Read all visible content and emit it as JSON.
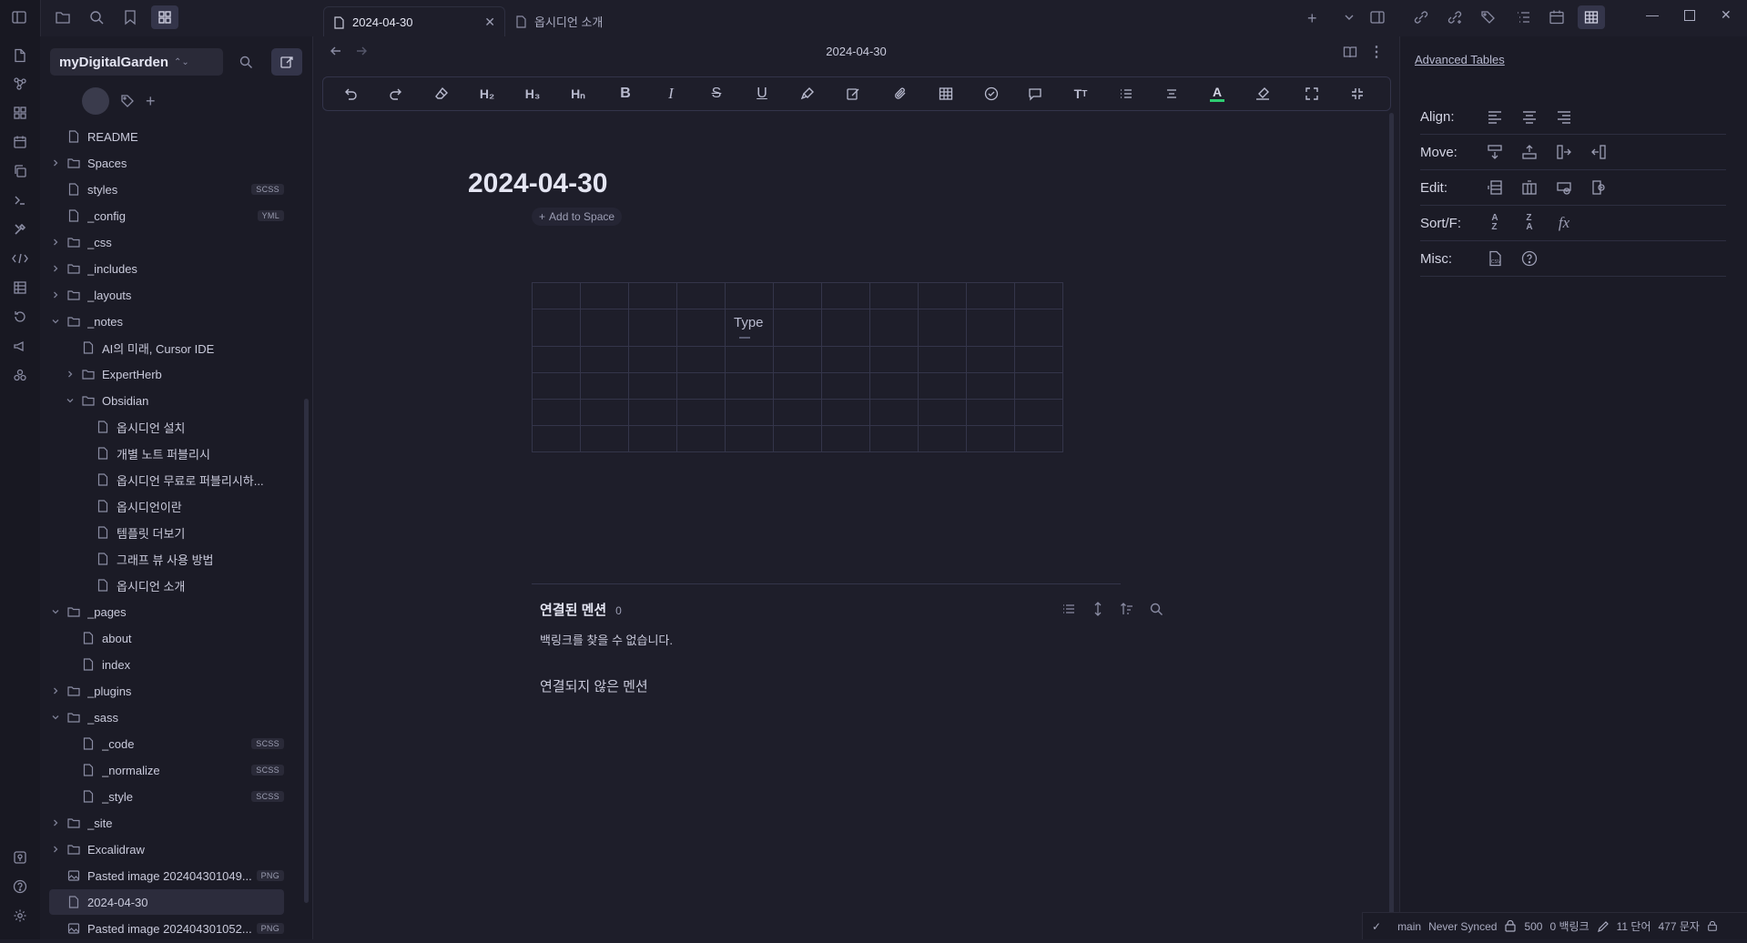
{
  "topbar": {
    "tabs": [
      {
        "label": "2024-04-30",
        "active": true
      },
      {
        "label": "옵시디언 소개",
        "active": false
      }
    ]
  },
  "sidebar": {
    "vault_name": "myDigitalGarden",
    "tree": [
      {
        "name": "README",
        "type": "file",
        "depth": 0
      },
      {
        "name": "Spaces",
        "type": "folder",
        "depth": 0,
        "expanded": false
      },
      {
        "name": "styles",
        "type": "file",
        "depth": 0,
        "badge": "SCSS"
      },
      {
        "name": "_config",
        "type": "file",
        "depth": 0,
        "badge": "YML"
      },
      {
        "name": "_css",
        "type": "folder",
        "depth": 0,
        "expanded": false
      },
      {
        "name": "_includes",
        "type": "folder",
        "depth": 0,
        "expanded": false
      },
      {
        "name": "_layouts",
        "type": "folder",
        "depth": 0,
        "expanded": false
      },
      {
        "name": "_notes",
        "type": "folder",
        "depth": 0,
        "expanded": true
      },
      {
        "name": "AI의 미래, Cursor IDE",
        "type": "file",
        "depth": 1
      },
      {
        "name": "ExpertHerb",
        "type": "folder",
        "depth": 1,
        "expanded": false
      },
      {
        "name": "Obsidian",
        "type": "folder",
        "depth": 1,
        "expanded": true
      },
      {
        "name": "옵시디언 설치",
        "type": "file",
        "depth": 2
      },
      {
        "name": "개별 노트 퍼블리시",
        "type": "file",
        "depth": 2
      },
      {
        "name": "옵시디언 무료로 퍼블리시하...",
        "type": "file",
        "depth": 2
      },
      {
        "name": "옵시디언이란",
        "type": "file",
        "depth": 2
      },
      {
        "name": "템플릿 더보기",
        "type": "file",
        "depth": 2
      },
      {
        "name": "그래프 뷰 사용 방법",
        "type": "file",
        "depth": 2
      },
      {
        "name": "옵시디언 소개",
        "type": "file",
        "depth": 2
      },
      {
        "name": "_pages",
        "type": "folder",
        "depth": 0,
        "expanded": true
      },
      {
        "name": "about",
        "type": "file",
        "depth": 1
      },
      {
        "name": "index",
        "type": "file",
        "depth": 1
      },
      {
        "name": "_plugins",
        "type": "folder",
        "depth": 0,
        "expanded": false
      },
      {
        "name": "_sass",
        "type": "folder",
        "depth": 0,
        "expanded": true
      },
      {
        "name": "_code",
        "type": "file",
        "depth": 1,
        "badge": "SCSS"
      },
      {
        "name": "_normalize",
        "type": "file",
        "depth": 1,
        "badge": "SCSS"
      },
      {
        "name": "_style",
        "type": "file",
        "depth": 1,
        "badge": "SCSS"
      },
      {
        "name": "_site",
        "type": "folder",
        "depth": 0,
        "expanded": false
      },
      {
        "name": "Excalidraw",
        "type": "folder",
        "depth": 0,
        "expanded": false
      },
      {
        "name": "Pasted image 202404301049...",
        "type": "image",
        "depth": 0,
        "badge": "PNG"
      },
      {
        "name": "2024-04-30",
        "type": "file",
        "depth": 0,
        "active": true
      },
      {
        "name": "Pasted image 202404301052...",
        "type": "image",
        "depth": 0,
        "badge": "PNG"
      }
    ]
  },
  "editor": {
    "header_title": "2024-04-30",
    "note_title": "2024-04-30",
    "add_to_space": "Add to Space",
    "table_placeholder": "Type",
    "backlinks_title": "연결된 멘션",
    "backlinks_count": "0",
    "backlinks_empty": "백링크를 찾을 수 없습니다.",
    "unlinked_title": "연결되지 않은 멘션"
  },
  "rpanel": {
    "title": "Advanced Tables",
    "rows": [
      {
        "label": "Align:"
      },
      {
        "label": "Move:"
      },
      {
        "label": "Edit:"
      },
      {
        "label": "Sort/F:"
      },
      {
        "label": "Misc:"
      }
    ]
  },
  "status": {
    "branch": "main",
    "sync": "Never Synced",
    "count": "500",
    "backlinks": "0 백링크",
    "words": "11 단어",
    "chars": "477 문자"
  }
}
